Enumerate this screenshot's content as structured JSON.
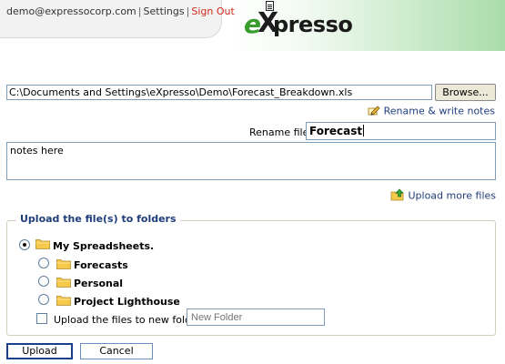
{
  "header": {
    "user_email": "demo@expressocorp.com",
    "separator": "|",
    "settings_label": "Settings",
    "signout_label": "Sign Out",
    "logo": {
      "e": "e",
      "x": "X",
      "rest": "presso"
    }
  },
  "form": {
    "file_path": "C:\\Documents and Settings\\eXpresso\\Demo\\Forecast_Breakdown.xls",
    "browse_label": "Browse...",
    "rename_notes_link": "Rename & write notes",
    "rename_label": "Rename file:",
    "rename_value": "Forecast",
    "notes_value": "notes here",
    "upload_more_link": "Upload more files"
  },
  "folders_section": {
    "legend": "Upload the file(s) to folders",
    "root": {
      "label": "My Spreadsheets.",
      "selected": true
    },
    "children": [
      {
        "label": "Forecasts",
        "selected": false
      },
      {
        "label": "Personal",
        "selected": false
      },
      {
        "label": "Project Lighthouse",
        "selected": false
      }
    ],
    "new_folder_label": "Upload the files to new folder:",
    "new_folder_placeholder": "New Folder",
    "new_folder_checked": false
  },
  "actions": {
    "upload_label": "Upload",
    "cancel_label": "Cancel"
  },
  "colors": {
    "link_blue": "#1f3d7a",
    "signout_red": "#d12a1d",
    "brand_green": "#3a9e2f",
    "folder_yellow": "#f6c94a"
  },
  "icons": {
    "rename_notes": "pencil-note-icon",
    "upload_more": "upload-arrow-icon",
    "folder": "folder-icon"
  }
}
